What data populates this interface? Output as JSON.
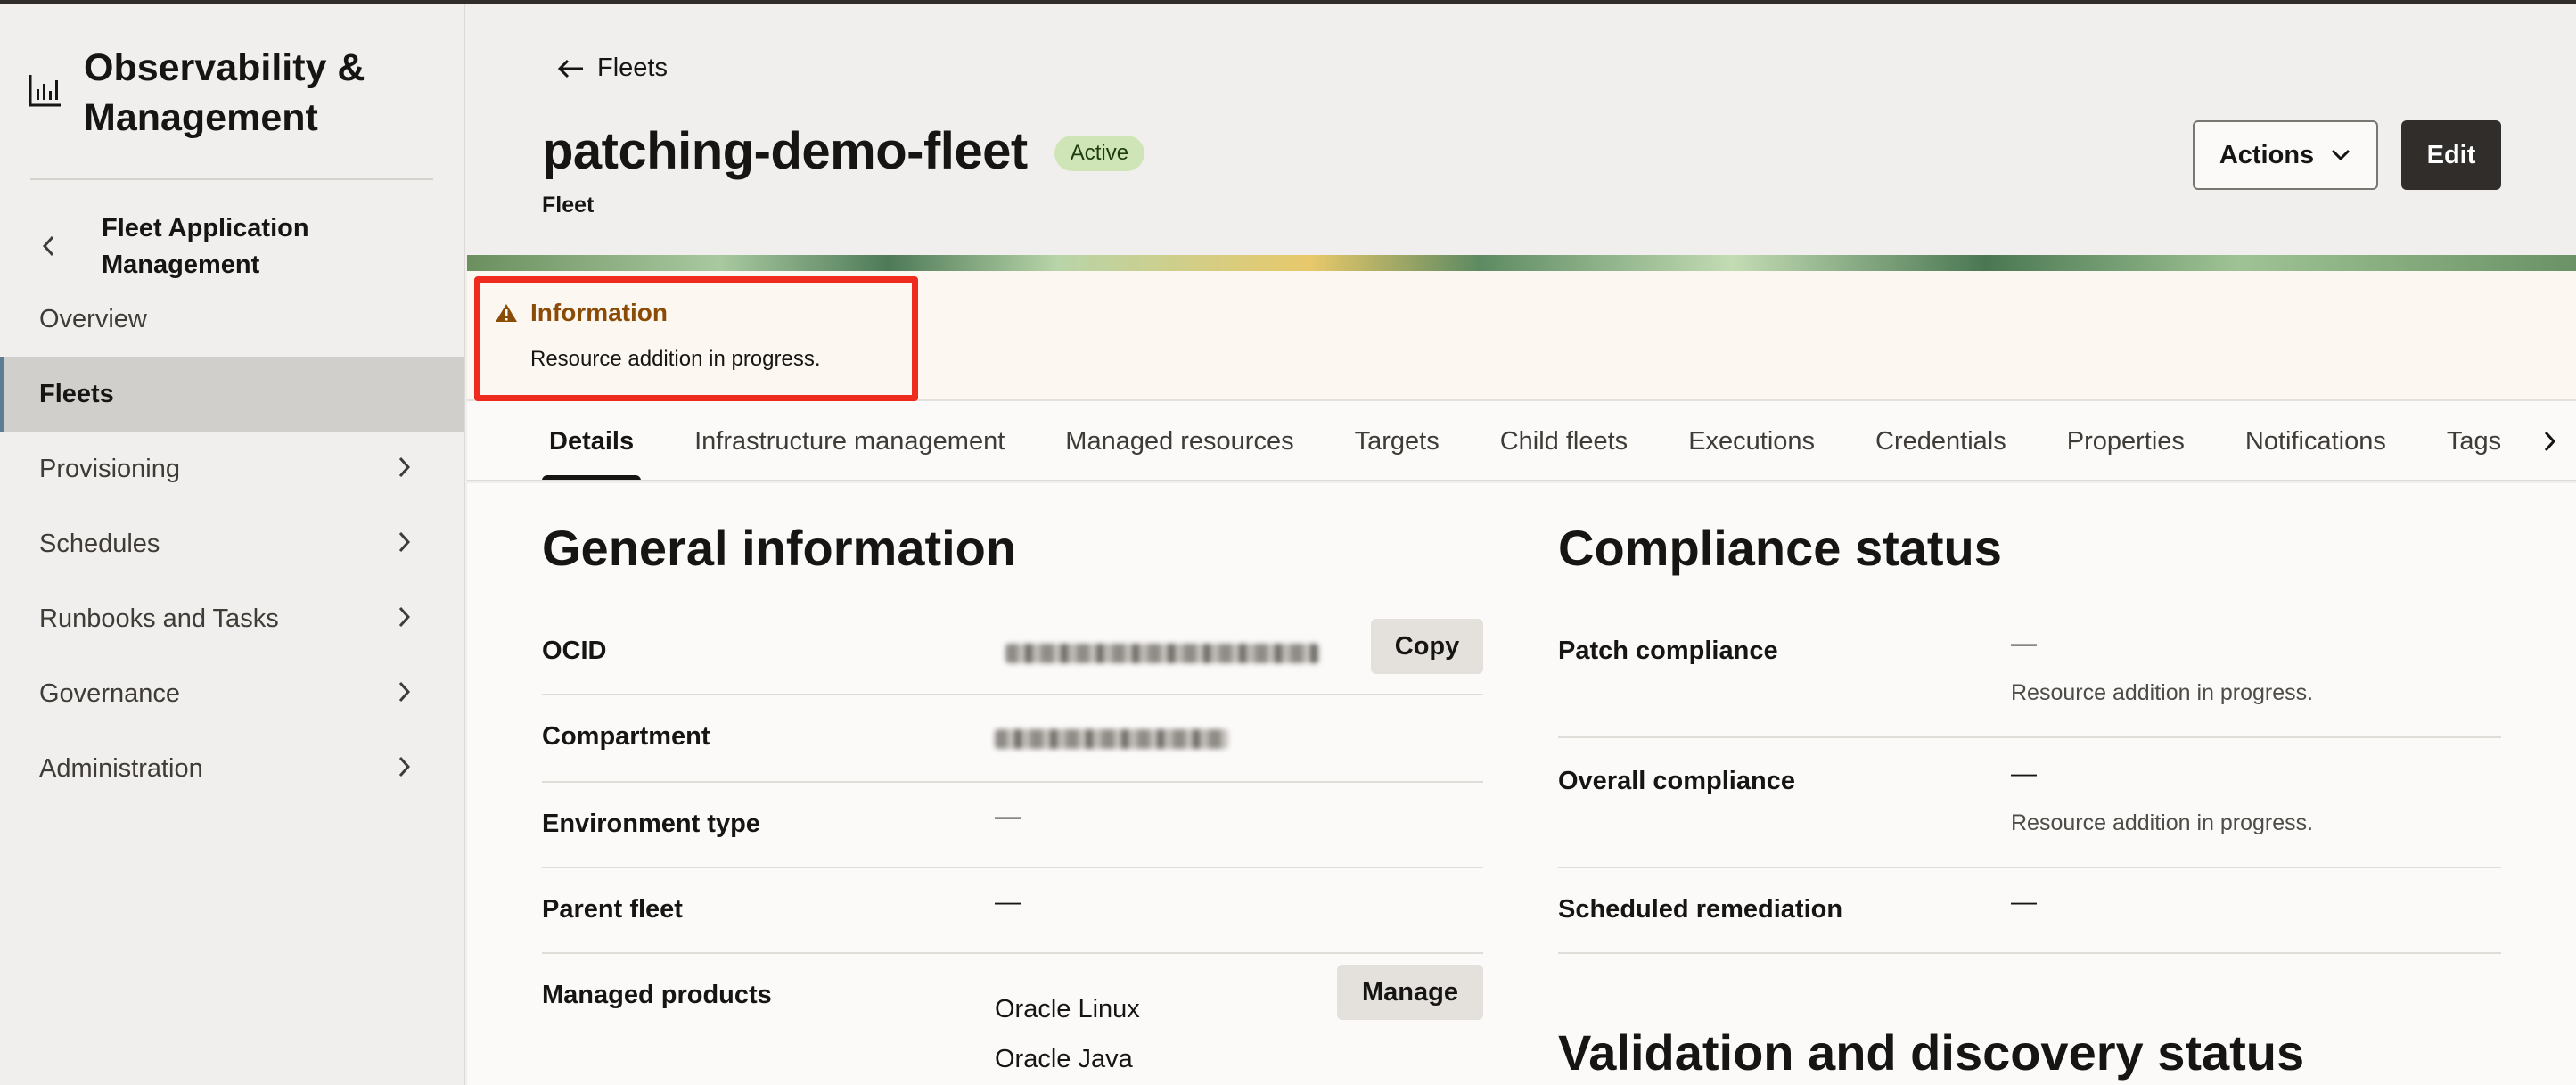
{
  "app": {
    "title": "Observability & Management"
  },
  "sidebar": {
    "back_label": "Fleet Application Management",
    "items": [
      {
        "label": "Overview",
        "has_chevron": false,
        "active": false
      },
      {
        "label": "Fleets",
        "has_chevron": false,
        "active": true
      },
      {
        "label": "Provisioning",
        "has_chevron": true,
        "active": false
      },
      {
        "label": "Schedules",
        "has_chevron": true,
        "active": false
      },
      {
        "label": "Runbooks and Tasks",
        "has_chevron": true,
        "active": false
      },
      {
        "label": "Governance",
        "has_chevron": true,
        "active": false
      },
      {
        "label": "Administration",
        "has_chevron": true,
        "active": false
      }
    ]
  },
  "header": {
    "breadcrumb": "Fleets",
    "title": "patching-demo-fleet",
    "status": "Active",
    "subtitle": "Fleet",
    "actions_label": "Actions",
    "edit_label": "Edit"
  },
  "info": {
    "title": "Information",
    "text": "Resource addition in progress."
  },
  "tabs": [
    "Details",
    "Infrastructure management",
    "Managed resources",
    "Targets",
    "Child fleets",
    "Executions",
    "Credentials",
    "Properties",
    "Notifications",
    "Tags"
  ],
  "general": {
    "title": "General information",
    "ocid_label": "OCID",
    "copy_label": "Copy",
    "compartment_label": "Compartment",
    "environment_label": "Environment type",
    "environment_value": "—",
    "parent_label": "Parent fleet",
    "parent_value": "—",
    "products_label": "Managed products",
    "products": [
      "Oracle Linux",
      "Oracle Java"
    ],
    "manage_label": "Manage"
  },
  "compliance": {
    "title": "Compliance status",
    "patch_label": "Patch compliance",
    "patch_value": "—",
    "patch_note": "Resource addition in progress.",
    "overall_label": "Overall compliance",
    "overall_value": "—",
    "overall_note": "Resource addition in progress.",
    "remediation_label": "Scheduled remediation",
    "remediation_value": "—"
  },
  "validation": {
    "title": "Validation and discovery status"
  },
  "colors": {
    "accent_dark": "#312d2a",
    "badge_bg": "#cfe5b8",
    "warning_text": "#8a4b07",
    "highlight_border": "#ee2b1e"
  }
}
